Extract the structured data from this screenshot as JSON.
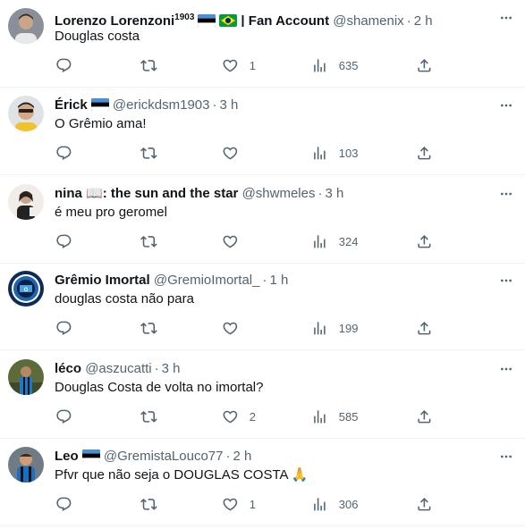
{
  "tweets": [
    {
      "name": "Lorenzo Lorenzoni",
      "name_sup": "1903",
      "name_suffix": "| Fan Account",
      "flags": [
        "estonia",
        "brazil"
      ],
      "handle": "@shamenix",
      "time": "2 h",
      "text": "Douglas costa",
      "replies": "",
      "retweets": "",
      "likes": "1",
      "views": "635",
      "avatar": "avatar-photo-young-man"
    },
    {
      "name": "Érick",
      "name_sup": "",
      "name_suffix": "",
      "flags": [
        "estonia"
      ],
      "handle": "@erickdsm1903",
      "time": "3 h",
      "text": "O Grêmio ama!",
      "replies": "",
      "retweets": "",
      "likes": "",
      "views": "103",
      "avatar": "avatar-photo-man-with-sunglasses"
    },
    {
      "name": "nina",
      "name_emoji": "📖",
      "name_suffix": ": the sun and the star",
      "flags": [],
      "handle": "@shwmeles",
      "time": "3 h",
      "text": "é meu pro geromel",
      "replies": "",
      "retweets": "",
      "likes": "",
      "views": "324",
      "avatar": "avatar-photo-person"
    },
    {
      "name": "Grêmio Imortal",
      "name_sup": "",
      "name_suffix": "",
      "flags": [],
      "handle": "@GremioImortal_",
      "time": "1 h",
      "text": "douglas costa não para",
      "replies": "",
      "retweets": "",
      "likes": "",
      "views": "199",
      "avatar": "avatar-gremio-badge"
    },
    {
      "name": "léco",
      "name_sup": "",
      "name_suffix": "",
      "flags": [],
      "handle": "@aszucatti",
      "time": "3 h",
      "text": "Douglas Costa de volta no imortal?",
      "replies": "",
      "retweets": "",
      "likes": "2",
      "views": "585",
      "avatar": "avatar-photo-player"
    },
    {
      "name": "Leo",
      "name_sup": "",
      "name_suffix": "",
      "flags": [
        "estonia"
      ],
      "handle": "@GremistaLouco77",
      "time": "2 h",
      "text": "Pfvr que não seja o DOUGLAS COSTA 🙏",
      "replies": "",
      "retweets": "",
      "likes": "1",
      "views": "306",
      "avatar": "avatar-photo-player-in-jersey"
    }
  ],
  "dot": "·",
  "icons": {
    "reply": "reply-icon",
    "retweet": "retweet-icon",
    "like": "heart-icon",
    "views": "views-icon",
    "share": "share-icon",
    "more": "more-icon"
  },
  "colors": {
    "text": "#0f1419",
    "secondary": "#536471",
    "divider": "#eff3f4"
  }
}
